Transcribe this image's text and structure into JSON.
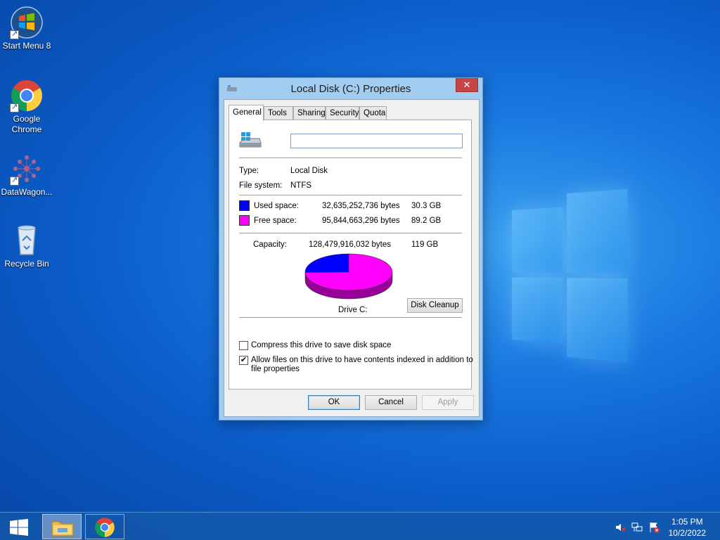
{
  "desktop": {
    "icons": [
      {
        "label": "Start Menu 8",
        "icon": "windows-orb-icon"
      },
      {
        "label": "Google Chrome",
        "icon": "chrome-icon"
      },
      {
        "label": "DataWagon...",
        "icon": "datawagon-icon"
      },
      {
        "label": "Recycle Bin",
        "icon": "recycle-bin-icon"
      }
    ]
  },
  "dialog": {
    "title": "Local Disk (C:) Properties",
    "close_label": "✕",
    "tabs": [
      "General",
      "Tools",
      "Sharing",
      "Security",
      "Quota"
    ],
    "active_tab": "General",
    "name_value": "",
    "type_label": "Type:",
    "type_value": "Local Disk",
    "fs_label": "File system:",
    "fs_value": "NTFS",
    "used": {
      "label": "Used space:",
      "bytes": "32,635,252,736 bytes",
      "size": "30.3 GB",
      "color": "#0000ff"
    },
    "free": {
      "label": "Free space:",
      "bytes": "95,844,663,296 bytes",
      "size": "89.2 GB",
      "color": "#ff00ff"
    },
    "capacity": {
      "label": "Capacity:",
      "bytes": "128,479,916,032 bytes",
      "size": "119 GB"
    },
    "drive_label": "Drive C:",
    "disk_cleanup_label": "Disk Cleanup",
    "compress_label": "Compress this drive to save disk space",
    "compress_checked": false,
    "index_label_1": "Allow files on this drive to have contents indexed in addition to",
    "index_label_2": "file properties",
    "index_checked": true,
    "ok_label": "OK",
    "cancel_label": "Cancel",
    "apply_label": "Apply"
  },
  "chart_data": {
    "type": "pie",
    "categories": [
      "Used space",
      "Free space"
    ],
    "values": [
      30.3,
      89.2
    ],
    "colors": [
      "#0000ff",
      "#ff00ff"
    ]
  },
  "taskbar": {
    "items": [
      "file-explorer-icon",
      "chrome-icon"
    ],
    "tray": [
      "volume-muted-icon",
      "network-icon",
      "action-center-flag-icon"
    ],
    "time": "1:05 PM",
    "date": "10/2/2022"
  }
}
